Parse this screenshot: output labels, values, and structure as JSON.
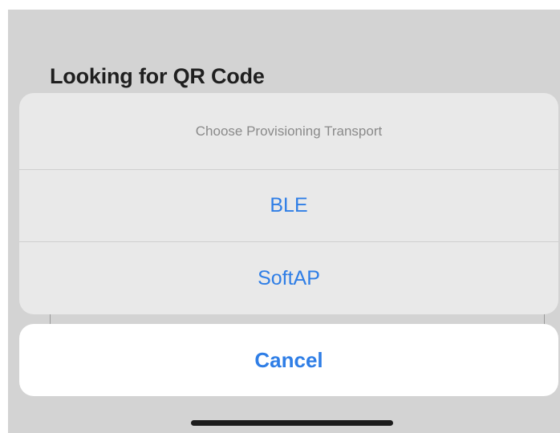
{
  "page": {
    "title": "Looking for QR Code"
  },
  "action_sheet": {
    "message": "Choose Provisioning Transport",
    "options": [
      {
        "label": "BLE"
      },
      {
        "label": "SoftAP"
      }
    ],
    "cancel_label": "Cancel"
  },
  "colors": {
    "overlay": "#d3d3d3",
    "sheet_background": "#e9e9e9",
    "cancel_background": "#ffffff",
    "action_blue": "#2f7ee6",
    "message_gray": "#8a8a8a",
    "home_indicator": "#1c1c1c"
  }
}
